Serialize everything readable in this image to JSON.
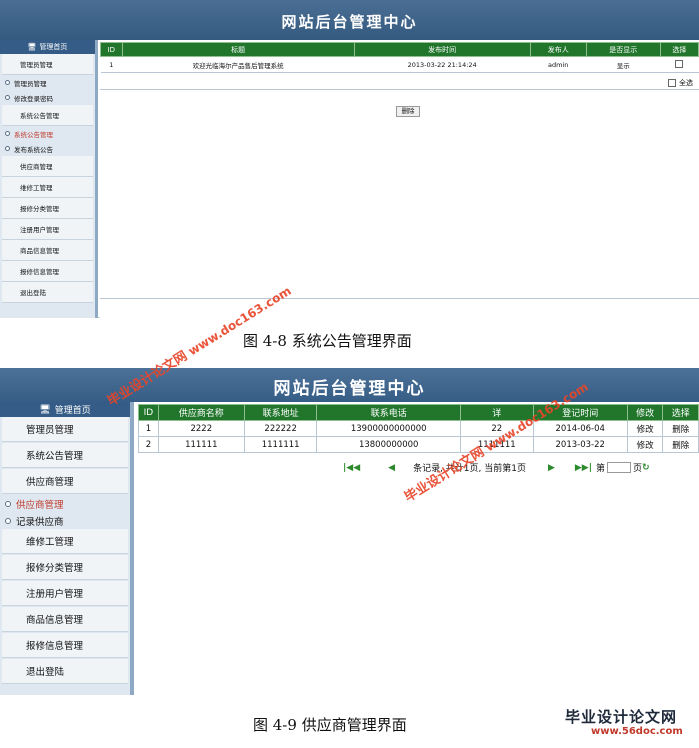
{
  "screen1": {
    "app_title": "网站后台管理中心",
    "sidebar": {
      "head": "管理首页",
      "items": [
        {
          "label": "管理员管理",
          "type": "item"
        },
        {
          "label": "管理员管理",
          "type": "sub"
        },
        {
          "label": "修改登录密码",
          "type": "sub"
        },
        {
          "label": "系统公告管理",
          "type": "item"
        },
        {
          "label": "系统公告管理",
          "type": "sub",
          "active": true
        },
        {
          "label": "发布系统公告",
          "type": "sub"
        },
        {
          "label": "供应商管理",
          "type": "item"
        },
        {
          "label": "维修工管理",
          "type": "item"
        },
        {
          "label": "报修分类管理",
          "type": "item"
        },
        {
          "label": "注册用户管理",
          "type": "item"
        },
        {
          "label": "商品信息管理",
          "type": "item"
        },
        {
          "label": "报修信息管理",
          "type": "item"
        },
        {
          "label": "退出登陆",
          "type": "item"
        }
      ]
    },
    "table": {
      "headers": [
        "ID",
        "标题",
        "发布时间",
        "发布人",
        "是否显示",
        "选择"
      ],
      "rows": [
        [
          "1",
          "欢迎光临海尔产品售后管理系统",
          "2013-03-22 21:14:24",
          "admin",
          "显示",
          ""
        ]
      ]
    },
    "select_all_label": "全选",
    "delete_button": "删除"
  },
  "caption1": "图 4-8    系统公告管理界面",
  "screen2": {
    "app_title": "网站后台管理中心",
    "sidebar": {
      "head": "管理首页",
      "items": [
        {
          "label": "管理员管理",
          "type": "item"
        },
        {
          "label": "系统公告管理",
          "type": "item"
        },
        {
          "label": "供应商管理",
          "type": "item"
        },
        {
          "label": "供应商管理",
          "type": "sub",
          "active": true
        },
        {
          "label": "记录供应商",
          "type": "sub"
        },
        {
          "label": "维修工管理",
          "type": "item"
        },
        {
          "label": "报修分类管理",
          "type": "item"
        },
        {
          "label": "注册用户管理",
          "type": "item"
        },
        {
          "label": "商品信息管理",
          "type": "item"
        },
        {
          "label": "报修信息管理",
          "type": "item"
        },
        {
          "label": "退出登陆",
          "type": "item"
        }
      ]
    },
    "table": {
      "headers": [
        "ID",
        "供应商名称",
        "联系地址",
        "联系电话",
        "详",
        "登记时间",
        "修改",
        "选择"
      ],
      "rows": [
        [
          "1",
          "2222",
          "222222",
          "13900000000000",
          "22",
          "2014-06-04",
          "修改",
          "删除"
        ],
        [
          "2",
          "111111",
          "1111111",
          "13800000000",
          "1111111",
          "2013-03-22",
          "修改",
          "删除"
        ]
      ]
    },
    "pager": {
      "first": "|◀◀",
      "prev": "◀",
      "info": "条记录, 共计1页, 当前第1页",
      "next": "▶",
      "last": "▶▶|",
      "page_label": "第",
      "page_suffix": "页"
    }
  },
  "caption2": "图 4-9    供应商管理界面",
  "watermarks": {
    "w1": "毕业设计论文网",
    "w2": "www.doc163.com"
  },
  "brand": {
    "name": "毕业设计论文网",
    "url": "www.56doc.com"
  }
}
